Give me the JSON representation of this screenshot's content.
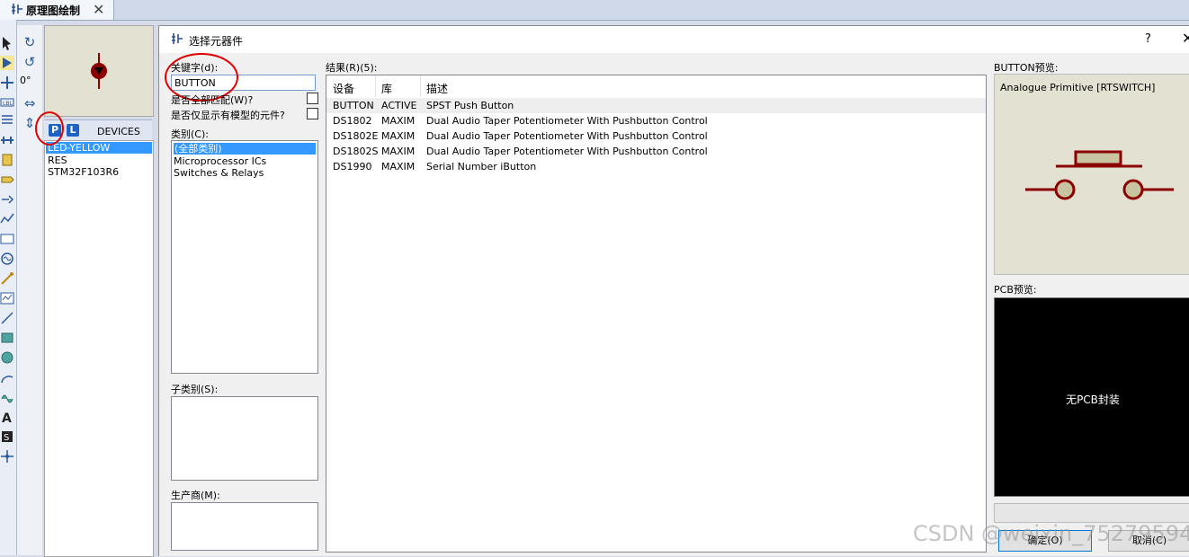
{
  "tab": {
    "label": "原理图绘制",
    "close": "✕"
  },
  "rotation": {
    "angle": "0°"
  },
  "devices": {
    "p_label": "P",
    "l_label": "L",
    "header": "DEVICES",
    "items": [
      "LED-YELLOW",
      "RES",
      "STM32F103R6"
    ],
    "selected": "LED-YELLOW"
  },
  "dialog": {
    "title": "选择元器件",
    "help": "?",
    "close": "✕",
    "keyword_label": "关键字(d):",
    "keyword_value": "BUTTON",
    "match_all_label": "是否全部匹配(W)?",
    "model_only_label": "是否仅显示有模型的元件?",
    "category_label": "类别(C):",
    "categories": [
      "(全部类别)",
      "Microprocessor ICs",
      "Switches & Relays"
    ],
    "subcategory_label": "子类别(S):",
    "manufacturer_label": "生产商(M):",
    "results_label": "结果(R)(5):",
    "results_columns": [
      "设备",
      "库",
      "描述"
    ],
    "results": [
      {
        "device": "BUTTON",
        "lib": "ACTIVE",
        "desc": "SPST Push Button"
      },
      {
        "device": "DS1802",
        "lib": "MAXIM",
        "desc": "Dual Audio Taper Potentiometer With Pushbutton Control"
      },
      {
        "device": "DS1802E",
        "lib": "MAXIM",
        "desc": "Dual Audio Taper Potentiometer With Pushbutton Control"
      },
      {
        "device": "DS1802S",
        "lib": "MAXIM",
        "desc": "Dual Audio Taper Potentiometer With Pushbutton Control"
      },
      {
        "device": "DS1990",
        "lib": "MAXIM",
        "desc": "Serial Number iButton"
      }
    ],
    "preview_label": "BUTTON预览:",
    "preview_caption": "Analogue Primitive [RTSWITCH]",
    "pcb_label": "PCB预览:",
    "pcb_message": "无PCB封装",
    "ok_label": "确定(O)",
    "cancel_label": "取消(C)"
  },
  "watermark": "CSDN @weixin_75279594",
  "colors": {
    "selection": "#3399ff",
    "schematic": "#8b0000",
    "annotation": "#e00000"
  }
}
